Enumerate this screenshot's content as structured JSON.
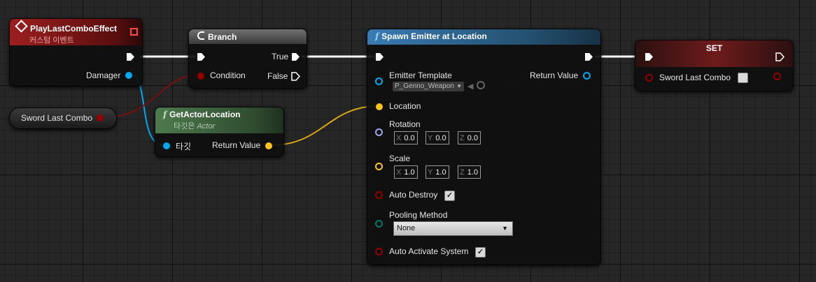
{
  "custom_event": {
    "title": "PlayLastComboEffect",
    "subtitle": "커스텀 이벤트",
    "damager_label": "Damager"
  },
  "variable_get": {
    "label": "Sword Last Combo"
  },
  "branch": {
    "title": "Branch",
    "true_label": "True",
    "condition_label": "Condition",
    "false_label": "False"
  },
  "get_actor_location": {
    "title": "GetActorLocation",
    "subtitle_target": "타깃은",
    "subtitle_class": "Actor",
    "target_label": "타깃",
    "return_label": "Return Value"
  },
  "spawn_emitter": {
    "title": "Spawn Emitter at Location",
    "emitter_template_label": "Emitter Template",
    "emitter_template_value": "P_Genno_Weapon",
    "return_label": "Return Value",
    "location_label": "Location",
    "rotation_label": "Rotation",
    "rotation": {
      "x": "0.0",
      "y": "0.0",
      "z": "0.0"
    },
    "scale_label": "Scale",
    "scale": {
      "x": "1.0",
      "y": "1.0",
      "z": "1.0"
    },
    "auto_destroy_label": "Auto Destroy",
    "auto_destroy": true,
    "pooling_label": "Pooling Method",
    "pooling_value": "None",
    "auto_activate_label": "Auto Activate System",
    "auto_activate": true
  },
  "set_node": {
    "title": "SET",
    "var_label": "Sword Last Combo",
    "value": false
  },
  "axis_labels": {
    "x": "X",
    "y": "Y",
    "z": "Z"
  },
  "colors": {
    "exec": "#ffffff",
    "object_pin": "#00a8f0",
    "bool_pin": "#940000",
    "vector_pin": "#fdc41c",
    "rotator_pin": "#9aa7f0",
    "enum_pin": "#00786b",
    "event_header": "#8b1c1c",
    "function_header": "#2a5578",
    "pure_header": "#3f6a3f"
  }
}
